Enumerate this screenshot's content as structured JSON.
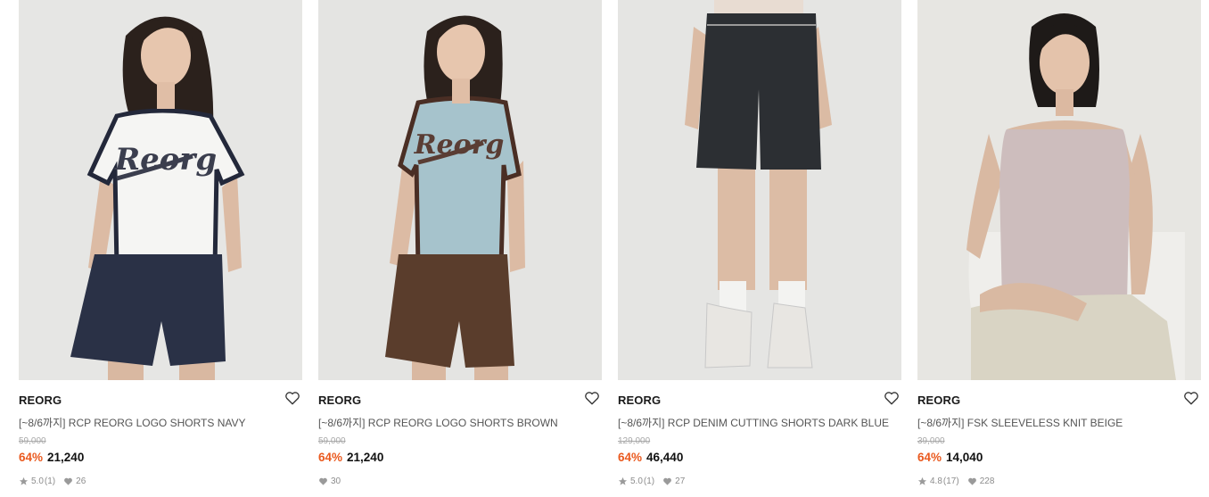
{
  "products": [
    {
      "brand": "REORG",
      "name": "[~8/6까지] RCP REORG LOGO SHORTS NAVY",
      "original_price": "59,000",
      "discount": "64%",
      "sale_price": "21,240",
      "rating": "5.0",
      "review_count": "(1)",
      "likes": "26",
      "image_desc": "model-white-ringer-tee-navy-shorts",
      "colors": {
        "bg": "#e6e6e4",
        "top": "#f5f5f3",
        "trim": "#23283a",
        "bottom": "#2a3146"
      }
    },
    {
      "brand": "REORG",
      "name": "[~8/6까지] RCP REORG LOGO SHORTS BROWN",
      "original_price": "59,000",
      "discount": "64%",
      "sale_price": "21,240",
      "likes": "30",
      "image_desc": "model-blue-ringer-tee-brown-shorts",
      "colors": {
        "bg": "#e4e4e2",
        "top": "#a6c3cc",
        "trim": "#4a2e24",
        "bottom": "#5a3d2c"
      }
    },
    {
      "brand": "REORG",
      "name": "[~8/6까지] RCP DENIM CUTTING SHORTS DARK BLUE",
      "original_price": "129,000",
      "discount": "64%",
      "sale_price": "46,440",
      "rating": "5.0",
      "review_count": "(1)",
      "likes": "27",
      "image_desc": "legs-dark-denim-shorts-white-sneakers",
      "colors": {
        "bg": "#e5e5e3",
        "bottom": "#2c2f33"
      }
    },
    {
      "brand": "REORG",
      "name": "[~8/6까지] FSK SLEEVELESS KNIT BEIGE",
      "original_price": "39,000",
      "discount": "64%",
      "sale_price": "14,040",
      "rating": "4.8",
      "review_count": "(17)",
      "likes": "228",
      "image_desc": "seated-model-pink-knit-camisole",
      "colors": {
        "bg": "#e7e6e2",
        "top": "#cdbdbd",
        "bottom": "#d9d4c4"
      }
    }
  ],
  "icons": {
    "wishlist": "heart-outline-icon",
    "rating": "star-icon",
    "likes": "heart-filled-icon"
  }
}
